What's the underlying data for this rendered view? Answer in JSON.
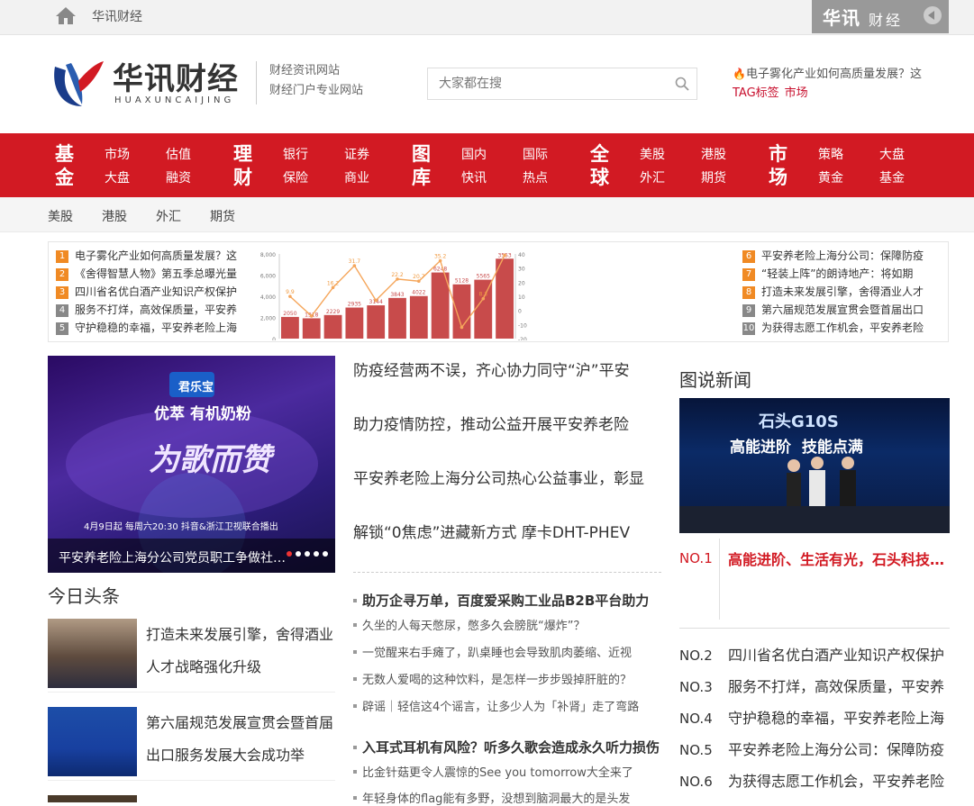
{
  "topbar": {
    "site_name": "华讯财经",
    "brand_cn": "华讯",
    "brand_cn2": "财经"
  },
  "logo": {
    "cn": "华讯财经",
    "en": "HUAXUNCAIJING"
  },
  "slogan": {
    "line1": "财经资讯网站",
    "line2": "财经门户专业网站"
  },
  "search": {
    "placeholder": "大家都在搜"
  },
  "hot": {
    "news": "电子雾化产业如何高质量发展？这",
    "tag_label": "TAG标签",
    "tag": "市场"
  },
  "nav": {
    "groups": [
      {
        "big": "基金",
        "items": [
          "市场",
          "估值",
          "大盘",
          "融资"
        ]
      },
      {
        "big": "理财",
        "items": [
          "银行",
          "证券",
          "保险",
          "商业"
        ]
      },
      {
        "big": "图库",
        "items": [
          "国内",
          "国际",
          "快讯",
          "热点"
        ]
      },
      {
        "big": "全球",
        "items": [
          "美股",
          "港股",
          "外汇",
          "期货"
        ]
      },
      {
        "big": "市场",
        "items": [
          "策略",
          "大盘",
          "黄金",
          "基金"
        ]
      }
    ]
  },
  "subnav": {
    "items": [
      "美股",
      "港股",
      "外汇",
      "期货"
    ]
  },
  "ranking_left": [
    {
      "num": "1",
      "text": "电子雾化产业如何高质量发展？这"
    },
    {
      "num": "2",
      "text": "《舍得智慧人物》第五季总曝光量"
    },
    {
      "num": "3",
      "text": "四川省名优白酒产业知识产权保护"
    },
    {
      "num": "4",
      "text": "服务不打烊，高效保质量，平安养"
    },
    {
      "num": "5",
      "text": "守护稳稳的幸福，平安养老险上海"
    }
  ],
  "ranking_right": [
    {
      "num": "6",
      "text": "平安养老险上海分公司：保障防疫"
    },
    {
      "num": "7",
      "text": "“轻装上阵”的朗诗地产：将如期"
    },
    {
      "num": "8",
      "text": "打造未来发展引擎，舍得酒业人才"
    },
    {
      "num": "9",
      "text": "第六届规范发展宣贯会暨首届出口"
    },
    {
      "num": "10",
      "text": "为获得志愿工作机会，平安养老险"
    }
  ],
  "chart_data": {
    "type": "bar",
    "categories": [
      "1",
      "2",
      "3",
      "4",
      "5",
      "6",
      "7",
      "8",
      "9",
      "10"
    ],
    "values": [
      2050,
      1918,
      2229,
      2935,
      3144,
      3843,
      4022,
      6248,
      5128,
      5565,
      7553
    ],
    "line_values": [
      9.9,
      -4.0,
      16.2,
      31.7,
      7.1,
      22.2,
      20.7,
      35.2,
      -12.0,
      8.3,
      39.1
    ],
    "bar_labels": [
      "2050",
      "1918",
      "2229",
      "2935",
      "3144",
      "3843",
      "4022",
      "6248",
      "5128",
      "5565",
      "3553"
    ],
    "line_labels": [
      "9.9",
      "",
      "16.2",
      "31.7",
      "",
      "22.2",
      "20.7",
      "35.2",
      "",
      "8.3",
      ""
    ],
    "y_ticks": [
      "8,000",
      "6,000",
      "4,000",
      "2,000",
      "0"
    ],
    "y2_ticks": [
      "40",
      "30",
      "20",
      "10",
      "0",
      "-10",
      "-20"
    ],
    "ylim": [
      0,
      8000
    ],
    "y2lim": [
      -20,
      40
    ],
    "colors": {
      "bar": "#c84b4b",
      "line": "#f5a65b"
    }
  },
  "banner": {
    "caption": "平安养老险上海分公司党员职工争做社…",
    "product": "君乐宝",
    "slogan": "优萃 有机奶粉",
    "show": "为歌而赞",
    "date_line": "4月9日起 每周六20:30 抖音&浙江卫视联合播出"
  },
  "toutiao": {
    "title": "今日头条",
    "items": [
      {
        "text": "打造未来发展引擎，舍得酒业人才战略强化升级"
      },
      {
        "text": "第六届规范发展宣贯会暨首届出口服务发展大会成功举"
      }
    ]
  },
  "mid_headlines": [
    "防疫经营两不误，齐心协力同守“沪”平安",
    "助力疫情防控，推动公益开展平安养老险",
    "平安养老险上海分公司热心公益事业，彰显",
    "解锁“0焦虑”进藏新方式 摩卡DHT-PHEV"
  ],
  "mid_sections": [
    {
      "bold": "助万企寻万单，百度爱采购工业品B2B平台助力",
      "items": [
        "久坐的人每天憋尿，憋多久会膀胱“爆炸”？",
        "一觉醒来右手瘫了，趴桌睡也会导致肌肉萎缩、近视",
        "无数人爱喝的这种饮料，是怎样一步步毁掉肝脏的？",
        "辟谣｜轻信这4个谣言，让多少人为「补肾」走了弯路"
      ]
    },
    {
      "bold": "入耳式耳机有风险？听多久歌会造成永久听力损伤",
      "items": [
        "比金针菇更令人震惊的See you tomorrow大全来了",
        "年轻身体的flag能有多野，没想到脑洞最大的是头发"
      ]
    }
  ],
  "pic_news": {
    "title": "图说新闻",
    "banner_text1": "石头G10S",
    "banner_text2": "高能进阶  技能点满",
    "no1_label": "NO.1",
    "no1_text": "高能进阶、生活有光，石头科技发布"
  },
  "right_ranking": [
    {
      "no": "NO.2",
      "text": "四川省名优白酒产业知识产权保护"
    },
    {
      "no": "NO.3",
      "text": "服务不打烊，高效保质量，平安养"
    },
    {
      "no": "NO.4",
      "text": "守护稳稳的幸福，平安养老险上海"
    },
    {
      "no": "NO.5",
      "text": "平安养老险上海分公司：保障防疫"
    },
    {
      "no": "NO.6",
      "text": "为获得志愿工作机会，平安养老险"
    }
  ]
}
